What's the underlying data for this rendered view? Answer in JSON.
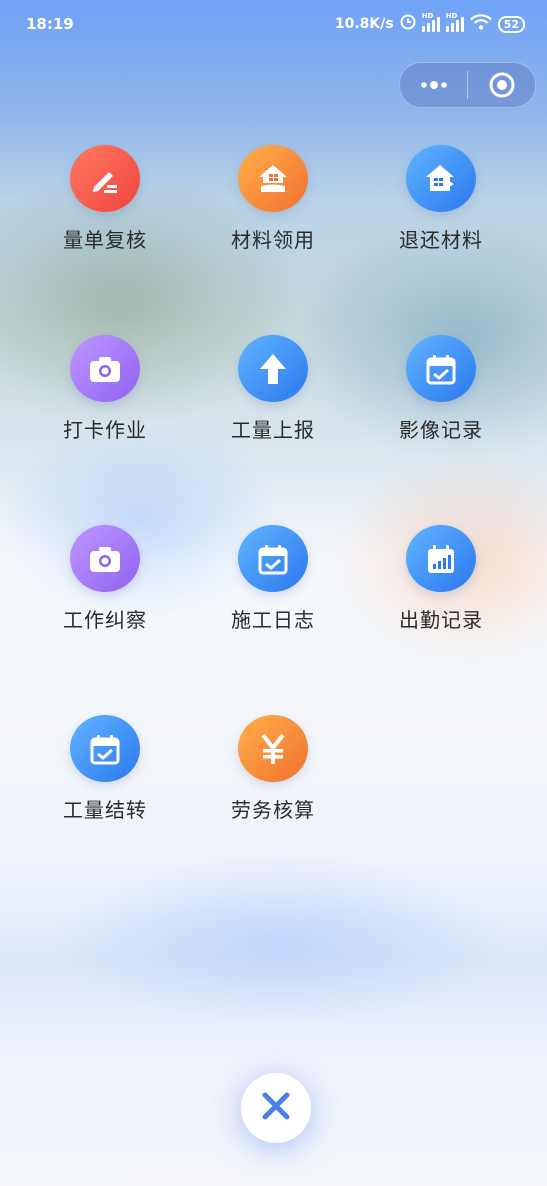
{
  "status_bar": {
    "time": "18:19",
    "network_speed": "10.8K/s",
    "hd_label": "HD",
    "battery": "52",
    "icons": [
      "alarm-icon",
      "signal-icon",
      "wifi-icon",
      "battery-icon"
    ]
  },
  "capsule": {
    "icons": [
      "more-icon",
      "target-icon"
    ]
  },
  "menu": {
    "items": [
      {
        "label": "量单复核",
        "icon": "pencil-list-icon",
        "color": "#f0433d"
      },
      {
        "label": "材料领用",
        "icon": "house-hand-icon",
        "color": "#f0702f"
      },
      {
        "label": "退还材料",
        "icon": "house-return-icon",
        "color": "#2c78ee"
      },
      {
        "label": "打卡作业",
        "icon": "camera-icon",
        "color": "#8e63f0"
      },
      {
        "label": "工量上报",
        "icon": "arrow-up-icon",
        "color": "#2c78ee"
      },
      {
        "label": "影像记录",
        "icon": "calendar-check-icon",
        "color": "#2c78ee"
      },
      {
        "label": "工作纠察",
        "icon": "camera-icon",
        "color": "#8e63f0"
      },
      {
        "label": "施工日志",
        "icon": "calendar-check-icon",
        "color": "#2c78ee"
      },
      {
        "label": "出勤记录",
        "icon": "calendar-chart-icon",
        "color": "#2c78ee"
      },
      {
        "label": "工量结转",
        "icon": "calendar-check-icon",
        "color": "#2c78ee"
      },
      {
        "label": "劳务核算",
        "icon": "yen-icon",
        "color": "#f0702f"
      }
    ]
  },
  "close_button": {
    "icon": "close-icon",
    "color": "#4a7fe6"
  }
}
